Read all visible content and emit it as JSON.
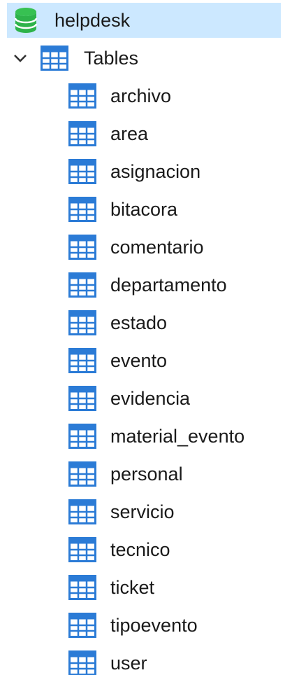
{
  "database": {
    "name": "helpdesk",
    "icon": "database-icon"
  },
  "tables_node": {
    "label": "Tables",
    "expanded": true,
    "icon": "table-icon"
  },
  "tables": [
    {
      "name": "archivo"
    },
    {
      "name": "area"
    },
    {
      "name": "asignacion"
    },
    {
      "name": "bitacora"
    },
    {
      "name": "comentario"
    },
    {
      "name": "departamento"
    },
    {
      "name": "estado"
    },
    {
      "name": "evento"
    },
    {
      "name": "evidencia"
    },
    {
      "name": "material_evento"
    },
    {
      "name": "personal"
    },
    {
      "name": "servicio"
    },
    {
      "name": "tecnico"
    },
    {
      "name": "ticket"
    },
    {
      "name": "tipoevento"
    },
    {
      "name": "user"
    }
  ],
  "colors": {
    "selection_bg": "#cce8ff",
    "db_icon": "#2eb34a",
    "table_icon": "#2b7bd6"
  }
}
